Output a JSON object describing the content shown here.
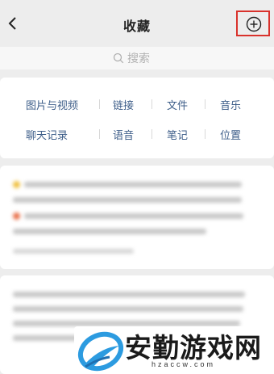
{
  "header": {
    "title": "收藏",
    "back_icon": "chevron-left-icon",
    "add_icon": "plus-circle-icon",
    "highlight_color": "#d9322c"
  },
  "search": {
    "placeholder": "搜索",
    "icon": "search-icon"
  },
  "categories": [
    {
      "label": "图片与视频"
    },
    {
      "label": "链接"
    },
    {
      "label": "文件"
    },
    {
      "label": "音乐"
    },
    {
      "label": "聊天记录"
    },
    {
      "label": "语音"
    },
    {
      "label": "笔记"
    },
    {
      "label": "位置"
    }
  ],
  "watermark": {
    "text": "安勤游戏网",
    "url": "hzaccw.com"
  },
  "colors": {
    "background": "#ededed",
    "category_text": "#3f5f8a"
  }
}
